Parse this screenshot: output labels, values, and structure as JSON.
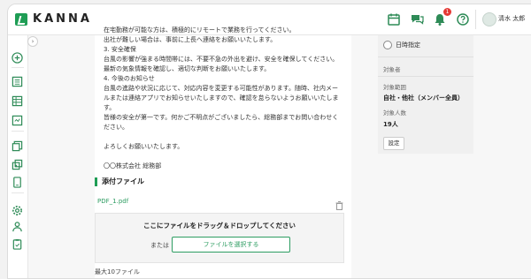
{
  "header": {
    "logo_text": "KANNA",
    "notification_count": "1",
    "user_name": "清水 太郎"
  },
  "icons": {
    "calendar": "calendar-icon",
    "chat": "chat-icon",
    "bell": "bell-icon",
    "help": "help-icon",
    "sidebar": [
      "plus-icon",
      "list-icon",
      "table-icon",
      "board-icon",
      "image-icon",
      "copy-icon",
      "phone-icon",
      "gear-icon",
      "person-icon",
      "clipboard-icon"
    ]
  },
  "colors": {
    "brand": "#1f9d55",
    "badge": "#e53935"
  },
  "body_lines": [
    "在宅勤務が可能な方は、積極的にリモートで業務を行ってください。",
    "出社が難しい場合は、事前に上長へ連絡をお願いいたします。",
    "3. 安全確保",
    "台風の影響が強まる時間帯には、不要不急の外出を避け、安全を確保してください。",
    "最新の気象情報を確認し、適切な判断をお願いいたします。",
    "4. 今後のお知らせ",
    "台風の進路や状況に応じて、対応内容を変更する可能性があります。随時、社内メー",
    "ルまたは連絡アプリでお知らせいたしますので、確認を怠らないようお願いいたしま",
    "す。",
    "皆様の安全が第一です。何かご不明点がございましたら、総務部までお問い合わせく",
    "ださい。",
    "",
    "よろしくお願いいたします。",
    "",
    "〇〇株式会社 総務部"
  ],
  "attachments": {
    "title": "添付ファイル",
    "file_name": "PDF_1.pdf",
    "dropzone_title": "ここにファイルをドラッグ＆ドロップしてください",
    "or_label": "または",
    "select_button": "ファイルを選択する",
    "max_files": "最大10ファイル"
  },
  "right_panel": {
    "radio_label": "日時指定",
    "target_label": "対象者",
    "scope_label": "対象範囲",
    "scope_value": "自社・他社（メンバー全員）",
    "count_label": "対象人数",
    "count_value": "19人",
    "settings_button": "設定"
  }
}
